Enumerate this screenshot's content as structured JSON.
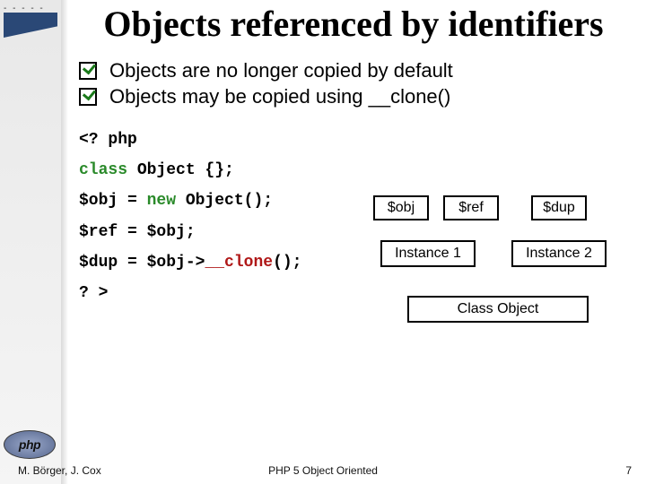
{
  "title": "Objects  referenced by identifiers",
  "bullets": [
    "Objects are no longer copied by default",
    "Objects may be copied using __clone()"
  ],
  "code": {
    "l1": "<? php",
    "l2_kw": "class",
    "l2_rest": " Object {};",
    "l3_pre": "$obj = ",
    "l3_kw": "new",
    "l3_post": " Object();",
    "l4": "$ref = $obj;",
    "l5_pre": "$dup = $obj->",
    "l5_sp": "__clone",
    "l5_post": "();",
    "l6": "? >"
  },
  "diagram": {
    "r1": {
      "a": "$obj",
      "b": "$ref",
      "c": "$dup"
    },
    "r2": {
      "a": "Instance 1",
      "b": "Instance 2"
    },
    "r3": {
      "a": "Class Object"
    }
  },
  "logo": "php",
  "footer": {
    "left": "M. Börger, J. Cox",
    "center": "PHP 5 Object Oriented",
    "right": "7"
  }
}
